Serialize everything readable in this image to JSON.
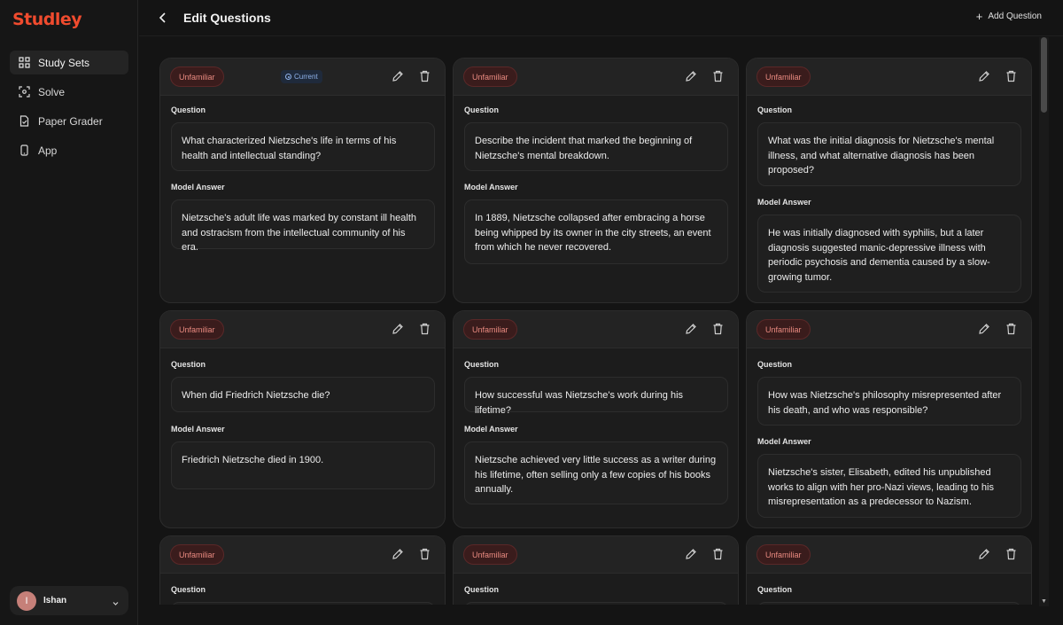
{
  "app": {
    "brand": "Studley",
    "brand_color": "#f04b2e"
  },
  "sidebar": {
    "items": [
      {
        "label": "Study Sets",
        "icon": "grid-icon",
        "active": true
      },
      {
        "label": "Solve",
        "icon": "scan-icon",
        "active": false
      },
      {
        "label": "Paper Grader",
        "icon": "document-check-icon",
        "active": false
      },
      {
        "label": "App",
        "icon": "phone-icon",
        "active": false
      }
    ],
    "user": {
      "initial": "I",
      "name": "Ishan"
    }
  },
  "header": {
    "title": "Edit Questions",
    "add_label": "Add Question"
  },
  "labels": {
    "question": "Question",
    "answer": "Model Answer",
    "current": "Current"
  },
  "cards": [
    {
      "status": "Unfamiliar",
      "current": true,
      "question": "What characterized Nietzsche's life in terms of his health and intellectual standing?",
      "answer": "Nietzsche's adult life was marked by constant ill health and ostracism from the intellectual community of his era."
    },
    {
      "status": "Unfamiliar",
      "current": false,
      "question": "Describe the incident that marked the beginning of Nietzsche's mental breakdown.",
      "answer": "In 1889, Nietzsche collapsed after embracing a horse being whipped by its owner in the city streets, an event from which he never recovered."
    },
    {
      "status": "Unfamiliar",
      "current": false,
      "question": "What was the initial diagnosis for Nietzsche's mental illness, and what alternative diagnosis has been proposed?",
      "answer": "He was initially diagnosed with syphilis, but a later diagnosis suggested manic-depressive illness with periodic psychosis and dementia caused by a slow-growing tumor."
    },
    {
      "status": "Unfamiliar",
      "current": false,
      "question": "When did Friedrich Nietzsche die?",
      "answer": "Friedrich Nietzsche died in 1900."
    },
    {
      "status": "Unfamiliar",
      "current": false,
      "question": "How successful was Nietzsche's work during his lifetime?",
      "answer": "Nietzsche achieved very little success as a writer during his lifetime, often selling only a few copies of his books annually."
    },
    {
      "status": "Unfamiliar",
      "current": false,
      "question": "How was Nietzsche's philosophy misrepresented after his death, and who was responsible?",
      "answer": "Nietzsche's sister, Elisabeth, edited his unpublished works to align with her pro-Nazi views, leading to his misrepresentation as a predecessor to Nazism."
    },
    {
      "status": "Unfamiliar",
      "current": false
    },
    {
      "status": "Unfamiliar",
      "current": false
    },
    {
      "status": "Unfamiliar",
      "current": false
    }
  ]
}
